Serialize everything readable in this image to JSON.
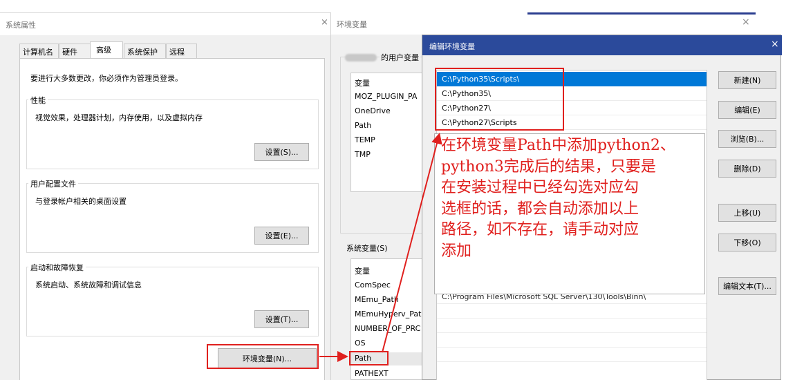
{
  "sysprops": {
    "title": "系统属性",
    "close": "×",
    "tabs": [
      "计算机名",
      "硬件",
      "高级",
      "系统保护",
      "远程"
    ],
    "admin_note": "要进行大多数更改，你必须作为管理员登录。",
    "performance": {
      "legend": "性能",
      "desc": "视觉效果，处理器计划，内存使用，以及虚拟内存",
      "button": "设置(S)..."
    },
    "user_profiles": {
      "legend": "用户配置文件",
      "desc": "与登录帐户相关的桌面设置",
      "button": "设置(E)..."
    },
    "startup": {
      "legend": "启动和故障恢复",
      "desc": "系统启动、系统故障和调试信息",
      "button": "设置(T)..."
    },
    "env_button": "环境变量(N)..."
  },
  "envvars": {
    "title": "环境变量",
    "close": "×",
    "user_label": "的用户变量",
    "user_list": {
      "header": "变量",
      "items": [
        "MOZ_PLUGIN_PA",
        "OneDrive",
        "Path",
        "TEMP",
        "TMP"
      ]
    },
    "sys_label": "系统变量(S)",
    "sys_list": {
      "header": "变量",
      "items": [
        "ComSpec",
        "MEmu_Path",
        "MEmuHyperv_Pat",
        "NUMBER_OF_PRC",
        "OS",
        "Path",
        "PATHEXT"
      ]
    }
  },
  "editdlg": {
    "title": "编辑环境变量",
    "close": "×",
    "entries": [
      "C:\\Python35\\Scripts\\",
      "C:\\Python35\\",
      "C:\\Python27\\",
      "C:\\Python27\\Scripts"
    ],
    "extra_entry": "C:\\Program Files\\Microsoft SQL Server\\130\\Tools\\Binn\\",
    "buttons": [
      "新建(N)",
      "编辑(E)",
      "浏览(B)...",
      "删除(D)",
      "上移(U)",
      "下移(O)",
      "编辑文本(T)..."
    ]
  },
  "annotation": {
    "lines": [
      "在环境变量Path中添加python2、",
      "python3完成后的结果，只要是",
      "在安装过程中已经勾选对应勾",
      "选框的话，都会自动添加以上",
      "路径，如不存在，请手动对应",
      "添加"
    ],
    "color": "#e0201e"
  },
  "colors": {
    "selection": "#0078d7",
    "edit_titlebar": "#2b4a9b",
    "dialog_bg": "#f0f0f0"
  }
}
